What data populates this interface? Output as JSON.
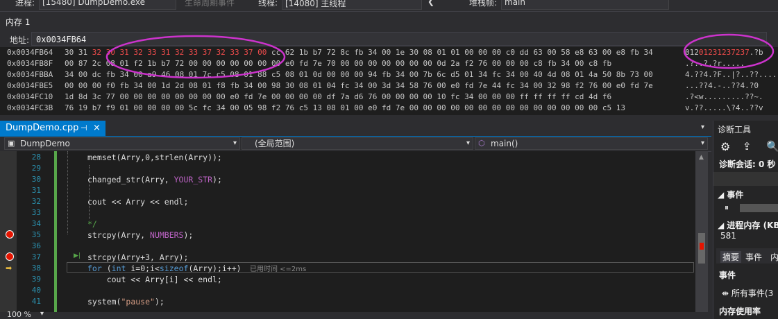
{
  "toolbar": {
    "process_label": "进程:",
    "process_value": "[15480] DumpDemo.exe",
    "lifecycle_label": "生命周期事件",
    "thread_label": "线程:",
    "thread_value": "[14080] 主线程",
    "stack_label": "堆栈帧:",
    "stack_value": "main"
  },
  "memory": {
    "title": "内存 1",
    "address_label": "地址:",
    "address_value": "0x0034FB64",
    "rows": [
      {
        "addr": "0x0034FB64",
        "pre": "30 31 ",
        "hl": "32 30 31 32 33 31 32 33 37 32 33 37 00",
        "post": " cc 62 1b b7 72 8c fb 34 00 1e 30 08 01 01 00 00 00 c0 dd 63 00 58 e8 63 00 e8 fb 34",
        "ascii_pre": "012",
        "ascii_hl": "01231237237",
        "ascii_post": ".?b"
      },
      {
        "addr": "0x0034FB8F",
        "pre": "00 87 2c 08 01 f2 1b b7 72 00 00 00 00 00 00 00 e0 fd 7e 70 00 00 00 00 00 00 00 0d 2a f2 76 00 00 00 c8 fb 34 00 c8 fb",
        "hl": "",
        "post": "",
        "ascii_pre": ".?..?.?r.....",
        "ascii_hl": "",
        "ascii_post": ""
      },
      {
        "addr": "0x0034FBBA",
        "pre": "34 00 dc fb 34 00 a9 46 08 01 7c c5 08 01 88 c5 08 01 0d 00 00 00 94 fb 34 00 7b 6c d5 01 34 fc 34 00 40 4d 08 01 4a 50 8b 73 00",
        "hl": "",
        "post": "",
        "ascii_pre": "4.??4.?F..|?..??....",
        "ascii_hl": "",
        "ascii_post": ""
      },
      {
        "addr": "0x0034FBE5",
        "pre": "00 00 00 f0 fb 34 00 1d 2d 08 01 f8 fb 34 00 98 30 08 01 04 fc 34 00 3d 34 58 76 00 e0 fd 7e 44 fc 34 00 32 98 f2 76 00 e0 fd 7e",
        "hl": "",
        "post": "",
        "ascii_pre": "...??4.-..??4.?0",
        "ascii_hl": "",
        "ascii_post": ""
      },
      {
        "addr": "0x0034FC10",
        "pre": "1d 8d 3c 77 00 00 00 00 00 00 00 00 e0 fd 7e 00 00 00 00 df 7a d6 76 00 00 00 00 10 fc 34 00 00 00 ff ff ff ff cd 4d f6",
        "hl": "",
        "post": "",
        "ascii_pre": ".?<w.........??~.",
        "ascii_hl": "",
        "ascii_post": ""
      },
      {
        "addr": "0x0034FC3B",
        "pre": "76 19 b7 f9 01 00 00 00 00 5c fc 34 00 05 98 f2 76 c5 13 08 01 00 e0 fd 7e 00 00 00 00 00 00 00 00 00 00 00 00 00 00 c5 13",
        "hl": "",
        "post": "",
        "ascii_pre": "v.??.....\\?4..??v",
        "ascii_hl": "",
        "ascii_post": ""
      }
    ]
  },
  "editor": {
    "tab_title": "DumpDemo.cpp",
    "tab_pin": "⊣",
    "tab_close": "×",
    "nav_project": "DumpDemo",
    "nav_scope": "(全局范围)",
    "nav_function": "main()",
    "zoom": "100 %",
    "lines": [
      {
        "n": "28",
        "html": "<span style='color:#dcdcdc'>memset(Arry,0,strlen(Arry));</span>"
      },
      {
        "n": "29",
        "html": ""
      },
      {
        "n": "30",
        "html": "<span style='color:#dcdcdc'>changed_str(Arry, <span class='mac'>YOUR_STR</span>);</span>"
      },
      {
        "n": "31",
        "html": ""
      },
      {
        "n": "32",
        "html": "<span style='color:#dcdcdc'>cout &lt;&lt; Arry &lt;&lt; endl;</span>"
      },
      {
        "n": "33",
        "html": ""
      },
      {
        "n": "34",
        "html": "<span class='cmt'>*/</span>"
      },
      {
        "n": "35",
        "html": "strcpy(Arry, <span class='mac'>NUMBERS</span>);"
      },
      {
        "n": "36",
        "html": ""
      },
      {
        "n": "37",
        "html": "strcpy(Arry+3, Arry);"
      },
      {
        "n": "38",
        "html": "<span class='kw'>for</span> (<span class='kw'>int</span> i=0;i&lt;<span class='kw'>sizeof</span>(Arry);i++)"
      },
      {
        "n": "39",
        "html": "    cout &lt;&lt; Arry[i] &lt;&lt; endl;"
      },
      {
        "n": "40",
        "html": ""
      },
      {
        "n": "41",
        "html": "system(<span class='str'>\"pause\"</span>);"
      }
    ],
    "elapsed_hint": "已用时间 <=2ms"
  },
  "diagnostics": {
    "title": "诊断工具",
    "session": "诊断会话: 0 秒",
    "events_header": "事件",
    "process_memory_header": "进程内存 (KB)",
    "process_memory_value": "581",
    "tabs": [
      "摘要",
      "事件",
      "内"
    ],
    "events_label": "事件",
    "all_events": "所有事件(3",
    "memory_usage": "内存使用率"
  },
  "annotation_color": "#cc33cc"
}
